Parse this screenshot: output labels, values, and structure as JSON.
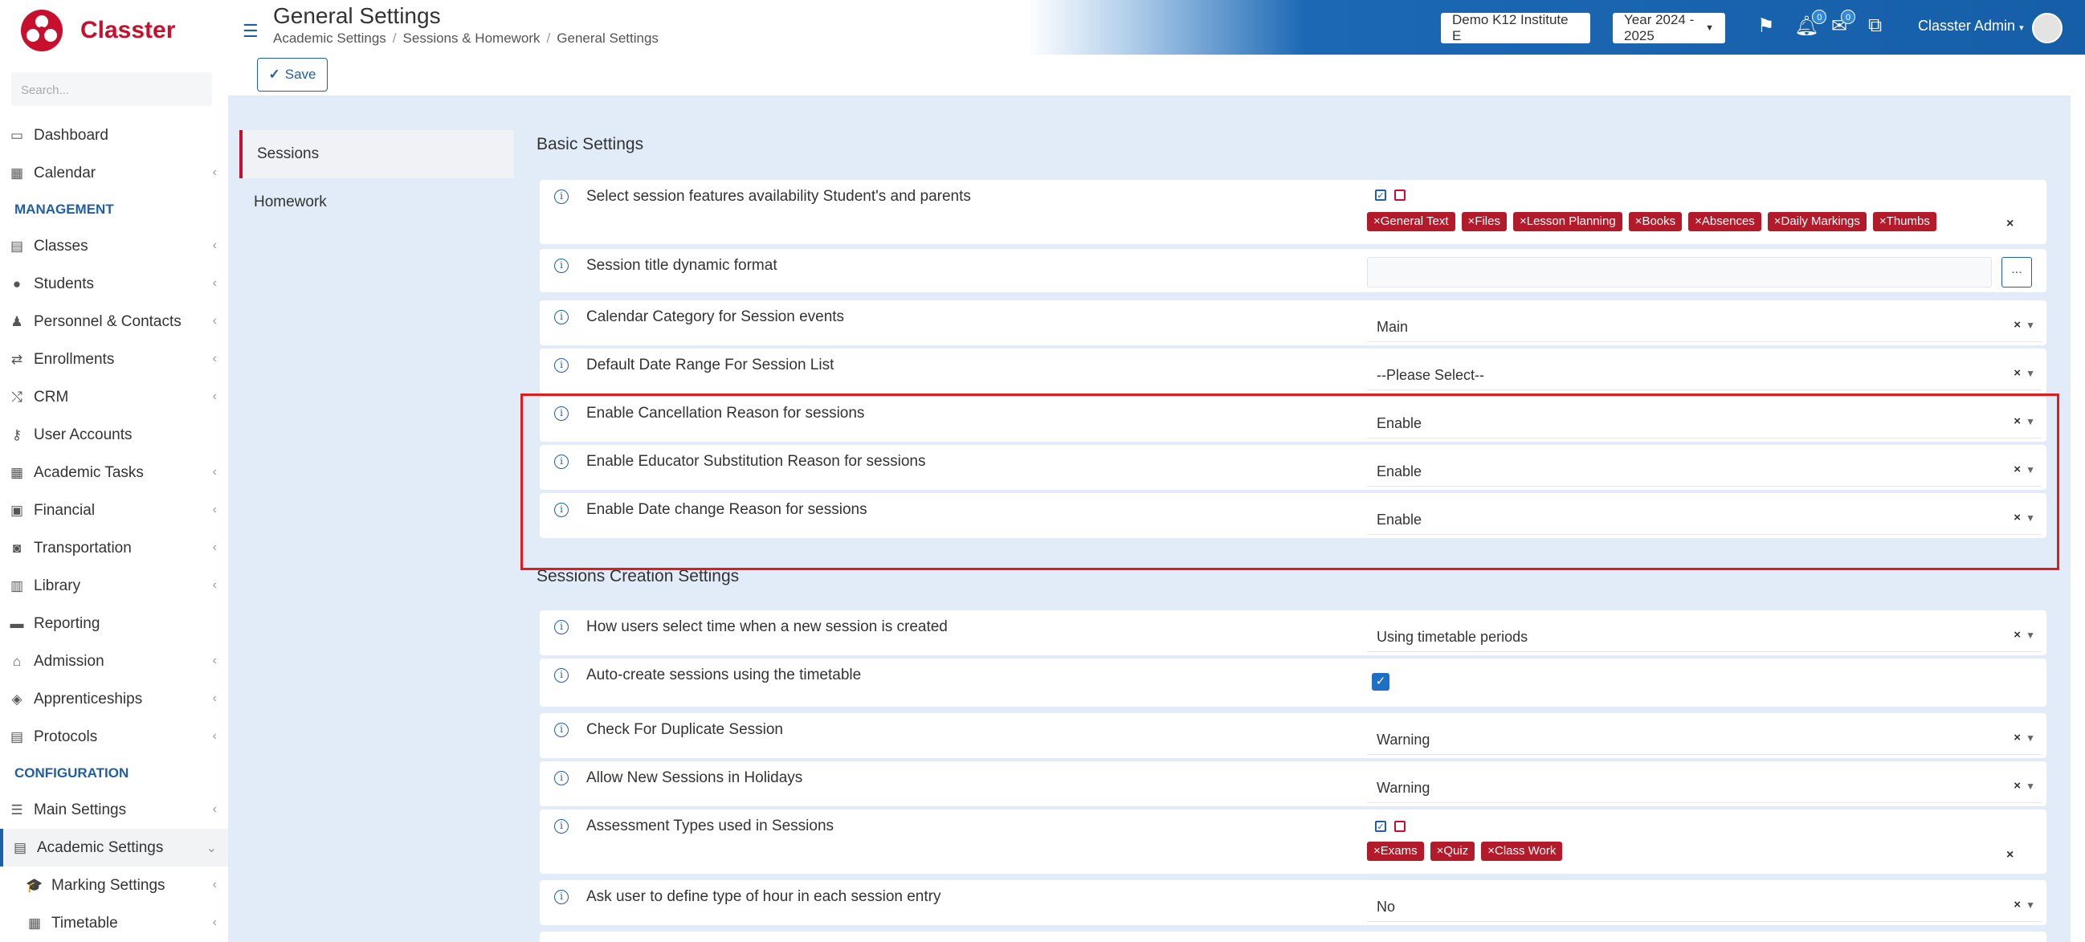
{
  "app": {
    "name": "Classter",
    "search_placeholder": "Search..."
  },
  "sidebar": {
    "items": [
      {
        "label": "Dashboard",
        "icon": "laptop-icon",
        "glyph": "▭"
      },
      {
        "label": "Calendar",
        "icon": "calendar-icon",
        "glyph": "▦",
        "chevron": "‹"
      },
      {
        "section": "MANAGEMENT"
      },
      {
        "label": "Classes",
        "icon": "classes-icon",
        "glyph": "▤",
        "chevron": "‹"
      },
      {
        "label": "Students",
        "icon": "students-icon",
        "glyph": "●",
        "chevron": "‹"
      },
      {
        "label": "Personnel & Contacts",
        "icon": "personnel-icon",
        "glyph": "♟",
        "chevron": "‹"
      },
      {
        "label": "Enrollments",
        "icon": "enrollments-icon",
        "glyph": "⇄",
        "chevron": "‹"
      },
      {
        "label": "CRM",
        "icon": "crm-icon",
        "glyph": "⤭",
        "chevron": "‹"
      },
      {
        "label": "User Accounts",
        "icon": "key-icon",
        "glyph": "⚷"
      },
      {
        "label": "Academic Tasks",
        "icon": "tasks-icon",
        "glyph": "▦",
        "chevron": "‹"
      },
      {
        "label": "Financial",
        "icon": "financial-icon",
        "glyph": "▣",
        "chevron": "‹"
      },
      {
        "label": "Transportation",
        "icon": "bus-icon",
        "glyph": "◙",
        "chevron": "‹"
      },
      {
        "label": "Library",
        "icon": "library-icon",
        "glyph": "▥",
        "chevron": "‹"
      },
      {
        "label": "Reporting",
        "icon": "print-icon",
        "glyph": "▬"
      },
      {
        "label": "Admission",
        "icon": "institution-icon",
        "glyph": "⌂",
        "chevron": "‹"
      },
      {
        "label": "Apprenticeships",
        "icon": "apprenticeships-icon",
        "glyph": "◈",
        "chevron": "‹"
      },
      {
        "label": "Protocols",
        "icon": "protocols-icon",
        "glyph": "▤",
        "chevron": "‹"
      },
      {
        "section": "CONFIGURATION"
      },
      {
        "label": "Main Settings",
        "icon": "sliders-icon",
        "glyph": "☰",
        "chevron": "‹"
      },
      {
        "label": "Academic Settings",
        "icon": "academic-settings-icon",
        "glyph": "▤",
        "chevron": "⌄",
        "active": true
      },
      {
        "label": "Marking Settings",
        "icon": "graduation-cap-icon",
        "glyph": "🎓",
        "chevron": "‹",
        "sub": true
      },
      {
        "label": "Timetable",
        "icon": "timetable-icon",
        "glyph": "▦",
        "chevron": "‹",
        "sub": true
      }
    ]
  },
  "header": {
    "title": "General Settings",
    "breadcrumbs": [
      "Academic Settings",
      "Sessions & Homework",
      "General Settings"
    ],
    "institute": "Demo K12 Institute E",
    "year": "Year 2024 - 2025",
    "notifications_count": "0",
    "messages_count": "0",
    "user": "Classter Admin"
  },
  "toolbar": {
    "save_label": "Save"
  },
  "tabs": [
    "Sessions",
    "Homework"
  ],
  "sections": {
    "basic": "Basic Settings",
    "creation": "Sessions Creation Settings"
  },
  "settings": {
    "features": {
      "label": "Select session features availability Student's and parents",
      "tags": [
        "General Text",
        "Files",
        "Lesson Planning",
        "Books",
        "Absences",
        "Daily Markings",
        "Thumbs"
      ]
    },
    "title_format": {
      "label": "Session title dynamic format",
      "button": "..."
    },
    "calendar_category": {
      "label": "Calendar Category for Session events",
      "value": "Main"
    },
    "date_range": {
      "label": "Default Date Range For Session List",
      "value": "--Please Select--"
    },
    "cancellation": {
      "label": "Enable Cancellation Reason for sessions",
      "value": "Enable"
    },
    "substitution": {
      "label": "Enable Educator Substitution Reason for sessions",
      "value": "Enable"
    },
    "date_change": {
      "label": "Enable Date change Reason for sessions",
      "value": "Enable"
    },
    "time_select": {
      "label": "How users select time when a new session is created",
      "value": "Using timetable periods"
    },
    "auto_create": {
      "label": "Auto-create sessions using the timetable",
      "checked": true
    },
    "duplicate": {
      "label": "Check For Duplicate Session",
      "value": "Warning"
    },
    "holidays": {
      "label": "Allow New Sessions in Holidays",
      "value": "Warning"
    },
    "assessment": {
      "label": "Assessment Types used in Sessions",
      "tags": [
        "Exams",
        "Quiz",
        "Class Work"
      ]
    },
    "hour_type": {
      "label": "Ask user to define type of hour in each session entry",
      "value": "No"
    }
  },
  "colors": {
    "brand": "#c8102e",
    "accent": "#1f5fa8",
    "tag": "#b31b2a",
    "highlight": "#e01c1c"
  }
}
